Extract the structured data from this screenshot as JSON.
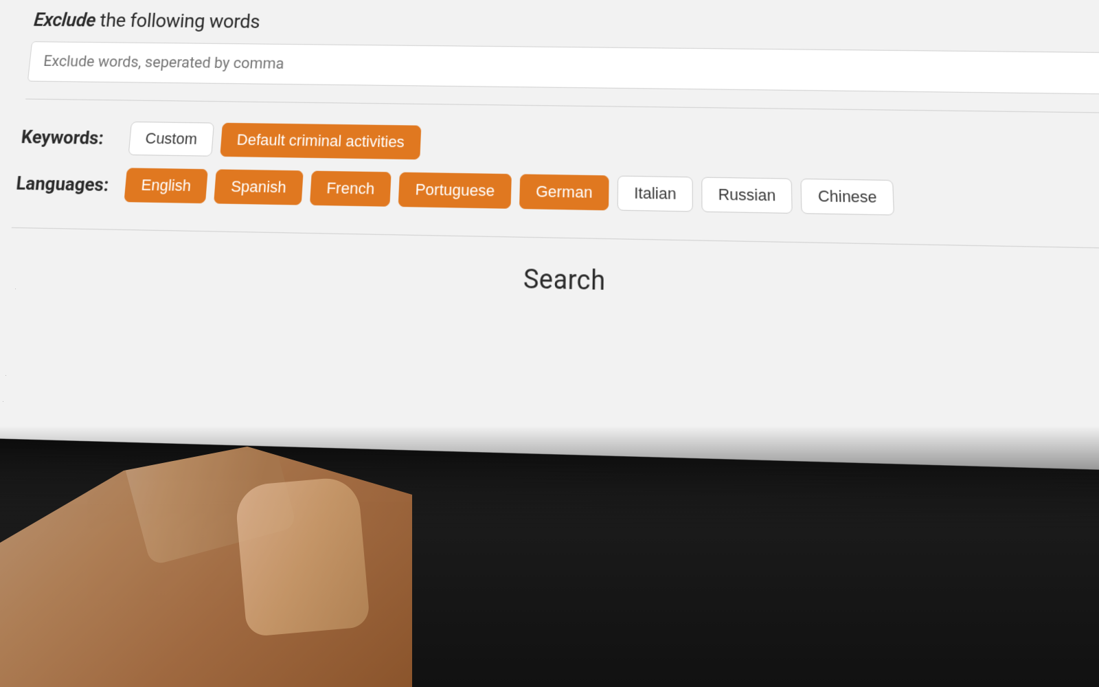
{
  "screen": {
    "exclude_section": {
      "title_prefix": "Exclude",
      "title_suffix": " the following words",
      "input_placeholder": "Exclude words, seperated by comma",
      "input_value": ""
    },
    "keywords_section": {
      "label": "Keywords:",
      "chips": [
        {
          "id": "custom",
          "label": "Custom",
          "active": false
        },
        {
          "id": "default-criminal",
          "label": "Default criminal activities",
          "active": true
        }
      ]
    },
    "languages_section": {
      "label": "Languages:",
      "chips": [
        {
          "id": "english",
          "label": "English",
          "active": true
        },
        {
          "id": "spanish",
          "label": "Spanish",
          "active": true
        },
        {
          "id": "french",
          "label": "French",
          "active": true
        },
        {
          "id": "portuguese",
          "label": "Portuguese",
          "active": true
        },
        {
          "id": "german",
          "label": "German",
          "active": true
        },
        {
          "id": "italian",
          "label": "Italian",
          "active": false
        },
        {
          "id": "russian",
          "label": "Russian",
          "active": false
        },
        {
          "id": "chinese",
          "label": "Chinese",
          "active": false
        }
      ]
    },
    "search_button_label": "Search"
  },
  "colors": {
    "accent": "#e07820",
    "accent_hover": "#c96810",
    "chip_inactive_bg": "#ffffff",
    "chip_inactive_border": "#cccccc",
    "chip_inactive_text": "#3a3a3a"
  }
}
